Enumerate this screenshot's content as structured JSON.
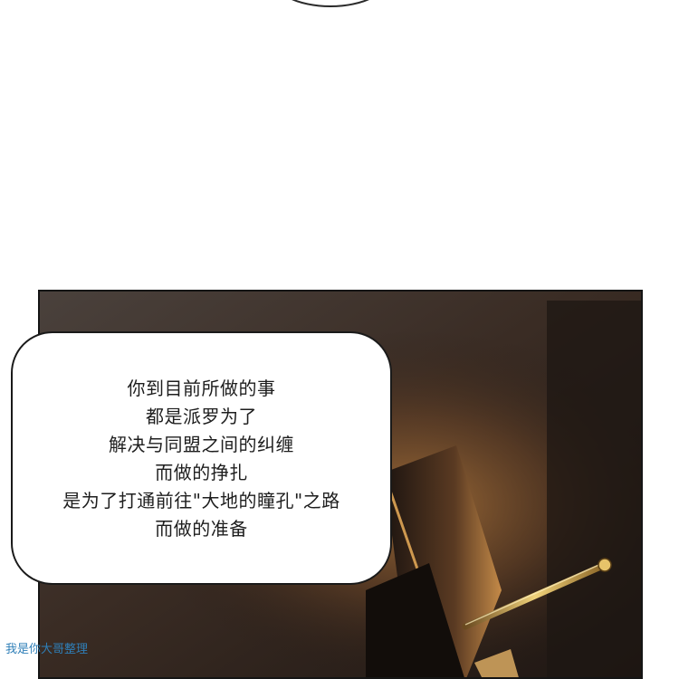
{
  "dialogue": {
    "lines": [
      "你到目前所做的事",
      "都是派罗为了",
      "解决与同盟之间的纠缠",
      "而做的挣扎",
      "是为了打通前往\"大地的瞳孔\"之路",
      "而做的准备"
    ]
  },
  "watermark": {
    "text": "我是你大哥整理"
  },
  "colors": {
    "panel_dark": "#2b221d",
    "panel_glow": "#c98b3e",
    "rod_highlight": "#e8c56a",
    "watermark": "#2f7fb8"
  },
  "illustration": {
    "subject": "dim interior scene with a gold-tipped rod and a glowing edge"
  }
}
